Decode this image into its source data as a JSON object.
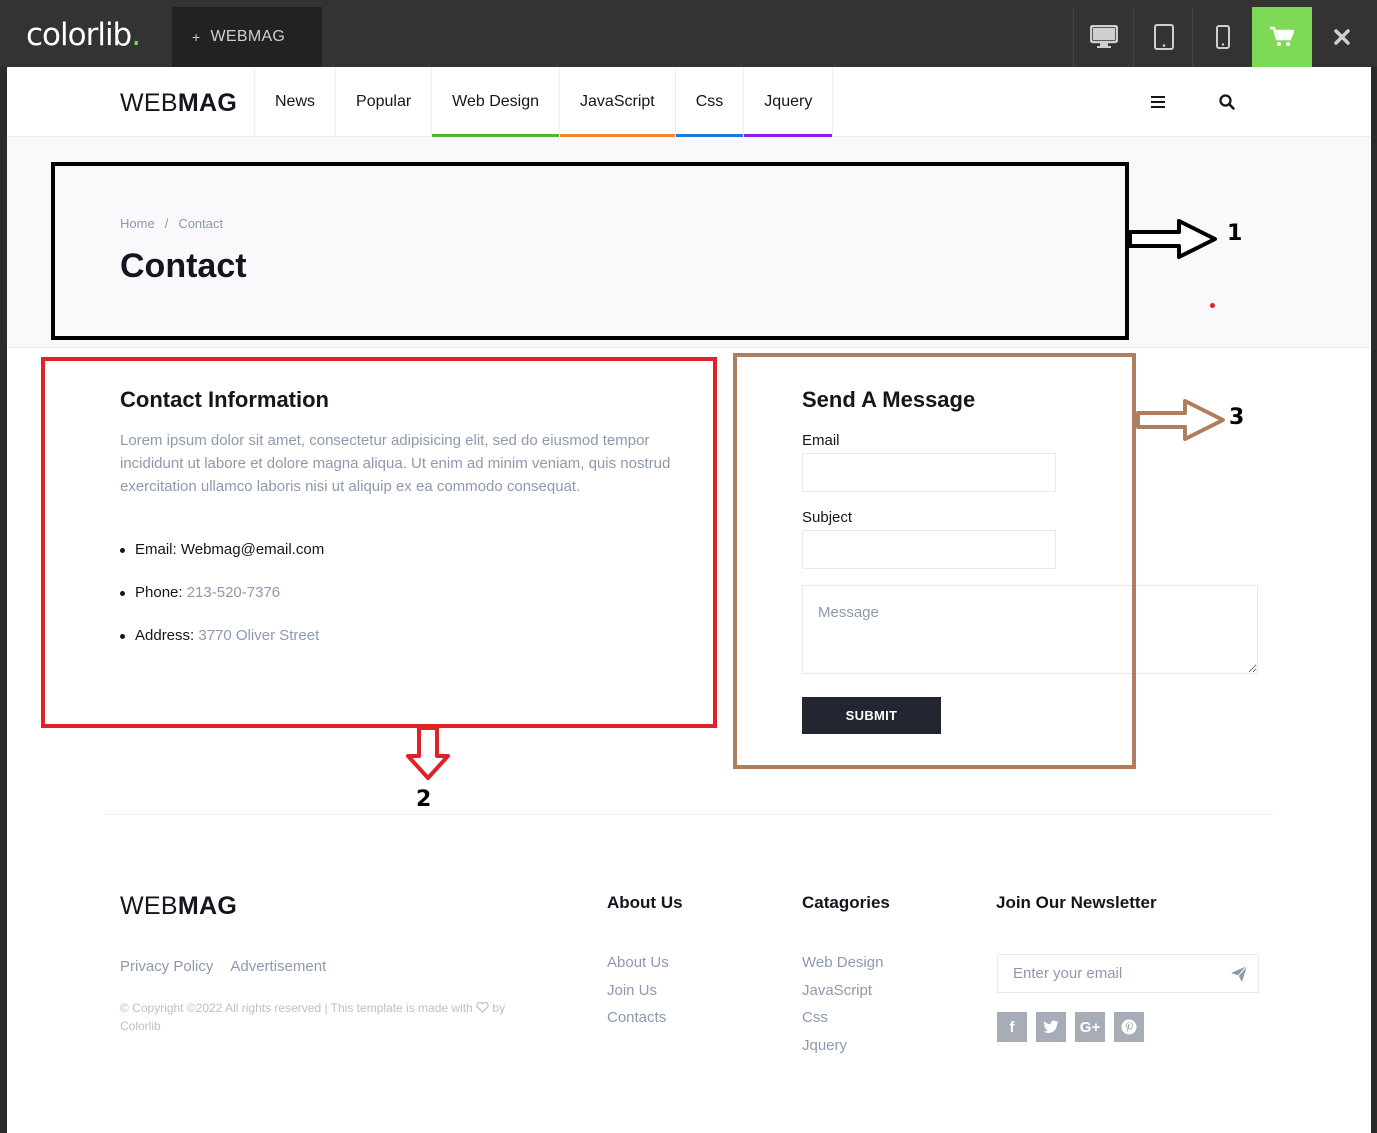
{
  "topbar": {
    "brand": "colorlib",
    "brand_dot": ".",
    "template_tab_plus": "+",
    "template_tab_label": "WEBMAG",
    "accent_color": "#7ed957"
  },
  "header": {
    "logo_light": "WEB",
    "logo_bold": "MAG",
    "nav": [
      {
        "label": "News",
        "color": ""
      },
      {
        "label": "Popular",
        "color": ""
      },
      {
        "label": "Web Design",
        "color": "#4bb92f"
      },
      {
        "label": "JavaScript",
        "color": "#ef862d"
      },
      {
        "label": "Css",
        "color": "#1a7bd6"
      },
      {
        "label": "Jquery",
        "color": "#8d20e3"
      }
    ]
  },
  "page_header": {
    "breadcrumb_home": "Home",
    "breadcrumb_sep": "/",
    "breadcrumb_current": "Contact",
    "title": "Contact"
  },
  "annotations": {
    "box1_label": "1",
    "box2_label": "2",
    "box3_label": "3",
    "box1_color": "#000000",
    "box2_color": "#e02127",
    "box3_color": "#b07e5e"
  },
  "contact_info": {
    "title": "Contact Information",
    "text": "Lorem ipsum dolor sit amet, consectetur adipisicing elit, sed do eiusmod tempor incididunt ut labore et dolore magna aliqua. Ut enim ad minim veniam, quis nostrud exercitation ullamco laboris nisi ut aliquip ex ea commodo consequat.",
    "email_label": "Email:",
    "email_value": "Webmag@email.com",
    "phone_label": "Phone:",
    "phone_value": "213-520-7376",
    "address_label": "Address:",
    "address_value": "3770 Oliver Street"
  },
  "form": {
    "title": "Send A Message",
    "email_label": "Email",
    "subject_label": "Subject",
    "message_placeholder": "Message",
    "submit_label": "SUBMIT"
  },
  "footer": {
    "logo_light": "WEB",
    "logo_bold": "MAG",
    "links": [
      "Privacy Policy",
      "Advertisement"
    ],
    "copyright": "© Copyright ©2022 All rights reserved | This template is made with",
    "copyright_by": "by",
    "copyright_author": "Colorlib",
    "about_title": "About Us",
    "about_links": [
      "About Us",
      "Join Us",
      "Contacts"
    ],
    "categories_title": "Catagories",
    "categories_links": [
      "Web Design",
      "JavaScript",
      "Css",
      "Jquery"
    ],
    "newsletter_title": "Join Our Newsletter",
    "newsletter_placeholder": "Enter your email",
    "social": [
      {
        "name": "facebook-icon",
        "glyph": "f"
      },
      {
        "name": "twitter-icon",
        "glyph": ""
      },
      {
        "name": "google-plus-icon",
        "glyph": "G+"
      },
      {
        "name": "pinterest-icon",
        "glyph": ""
      }
    ]
  }
}
